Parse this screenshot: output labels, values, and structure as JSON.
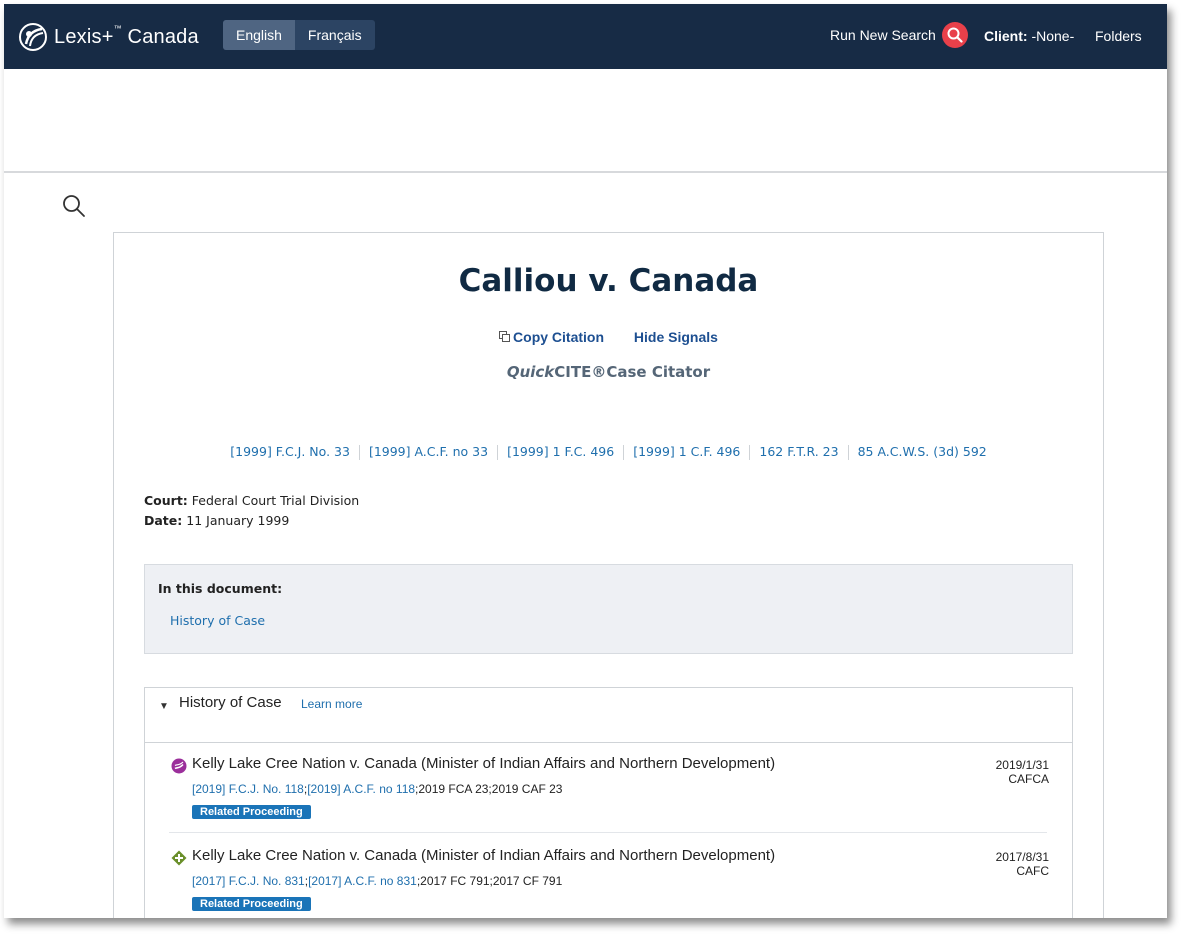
{
  "header": {
    "brand": "Lexis+",
    "brand_tm": "™",
    "brand_region": "Canada",
    "languages": [
      "English",
      "Français"
    ],
    "active_language": "English",
    "run_search_label": "Run New Search",
    "client_label": "Client:",
    "client_value": "-None-",
    "folders_label": "Folders"
  },
  "document": {
    "title": "Calliou v. Canada",
    "copy_citation": "Copy Citation",
    "hide_signals": "Hide Signals",
    "quickcite_italic": "Quick",
    "quickcite_rest": "CITE®Case Citator",
    "citations": [
      "[1999] F.C.J. No. 33",
      "[1999] A.C.F. no 33",
      "[1999] 1 F.C. 496",
      "[1999] 1 C.F. 496",
      "162 F.T.R. 23",
      "85 A.C.W.S. (3d) 592"
    ],
    "court_label": "Court:",
    "court_value": "Federal Court Trial Division",
    "date_label": "Date:",
    "date_value": "11 January 1999",
    "toc_title": "In this document:",
    "toc_link": "History of Case"
  },
  "history": {
    "title": "History of Case",
    "learn_more": "Learn more",
    "entries": [
      {
        "icon": "purple-signal-icon",
        "title": "Kelly Lake Cree Nation v. Canada (Minister of Indian Affairs and Northern Development)",
        "cite1": "[2019] F.C.J. No. 118",
        "cite2": "[2019] A.C.F. no 118",
        "cite_rest": ";2019 FCA 23;2019 CAF 23",
        "badge": "Related Proceeding",
        "date": "2019/1/31",
        "court": "CAFCA"
      },
      {
        "icon": "green-signal-icon",
        "title": "Kelly Lake Cree Nation v. Canada (Minister of Indian Affairs and Northern Development)",
        "cite1": "[2017] F.C.J. No. 831",
        "cite2": "[2017] A.C.F. no 831",
        "cite_rest": ";2017 FC 791;2017 CF 791",
        "badge": "Related Proceeding",
        "date": "2017/8/31",
        "court": "CAFC"
      }
    ]
  },
  "colors": {
    "topbar": "#172b45",
    "accent_red": "#e8404a",
    "link_blue": "#1f6fad",
    "badge_blue": "#1a74b8",
    "signal_purple": "#9b2f9b",
    "signal_green": "#6a8f2a"
  }
}
